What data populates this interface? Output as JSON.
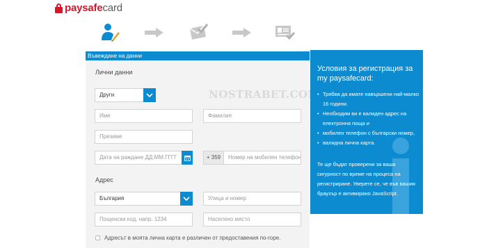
{
  "brand": {
    "logo_part1": "paysafe",
    "logo_part2": "card"
  },
  "steps": [
    {
      "icon": "user-edit-icon"
    },
    {
      "icon": "arrow-right-icon"
    },
    {
      "icon": "envelope-check-icon"
    },
    {
      "icon": "arrow-right-icon"
    },
    {
      "icon": "id-card-check-icon"
    }
  ],
  "form": {
    "header": "Въвеждане на данни",
    "personal_title": "Лични данни",
    "salutation": "Други",
    "first_name_placeholder": "Име",
    "last_name_placeholder": "Фамилия",
    "nickname_placeholder": "Презиме",
    "birthdate_placeholder": "Дата на раждане ДД.ММ.ГГГГ",
    "phone_prefix": "+ 359",
    "phone_placeholder": "Номер на мобилен телефон",
    "address_title": "Адрес",
    "country": "България",
    "street_placeholder": "Улица и номер",
    "postcode_placeholder": "Пощенски код, напр. 1234",
    "city_placeholder": "Населено място",
    "checkbox_label": "Адресът в моята лична карта е различен от предоставения по-горе."
  },
  "watermark": "NOSTRABET.COM",
  "info": {
    "title": "Условия за регистрация за my paysafecard:",
    "items": [
      "Трябва да имате навършени най-малко 16 години.",
      "Необходим ви е валиден адрес на електронна поща и",
      "мобилен телефон с български номер,",
      " валидна лична карта."
    ],
    "note": "Те ще бъдат проверени за ваша сигурност по време на процеса на регистриране. Уверете се, че във вашия браузър е активирано JavaScript."
  },
  "colors": {
    "accent": "#0d8bd1",
    "brand_red": "#d4182a",
    "form_bg": "#f3f3f3"
  }
}
